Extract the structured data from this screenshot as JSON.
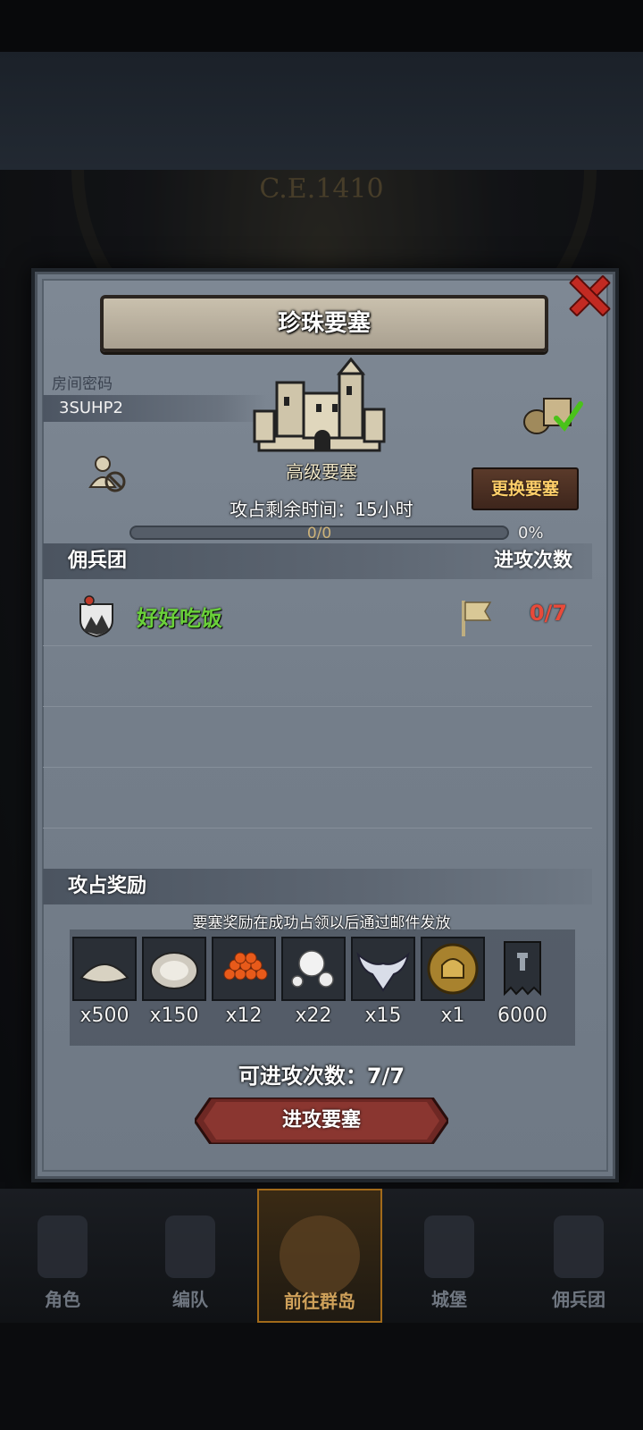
{
  "background": {
    "era_text": "C.E.1410"
  },
  "dialog": {
    "title": "珍珠要塞",
    "room_code_label": "房间密码",
    "room_code": "3SUHP2",
    "fortress_level": "高级要塞",
    "change_button": "更换要塞",
    "time_label": "攻占剩余时间：15小时",
    "progress": {
      "text": "0/0",
      "percent_text": "0%",
      "value": 0
    },
    "mercenary_section": {
      "left": "佣兵团",
      "right": "进攻次数"
    },
    "mercenary_rows": [
      {
        "name": "好好吃饭",
        "attacks": "0/7"
      }
    ],
    "reward_section": {
      "title": "攻占奖励",
      "note": "要塞奖励在成功占领以后通过邮件发放"
    },
    "rewards": [
      {
        "icon": "flour-pile-icon",
        "qty": "x500"
      },
      {
        "icon": "oyster-icon",
        "qty": "x150"
      },
      {
        "icon": "roe-icon",
        "qty": "x12"
      },
      {
        "icon": "pearls-icon",
        "qty": "x22"
      },
      {
        "icon": "winged-emblem-icon",
        "qty": "x15"
      },
      {
        "icon": "knight-coin-icon",
        "qty": "x1"
      },
      {
        "icon": "banner-icon",
        "qty": "6000"
      }
    ],
    "attack_count_label": "可进攻次数：7/7",
    "attack_button": "进攻要塞"
  },
  "tabbar": [
    {
      "label": "角色",
      "icon": "knight-icon"
    },
    {
      "label": "编队",
      "icon": "helmet-icon"
    },
    {
      "label": "前往群岛",
      "icon": "island-compass-icon",
      "active": true
    },
    {
      "label": "城堡",
      "icon": "castle-icon"
    },
    {
      "label": "佣兵团",
      "icon": "mercenary-icon"
    }
  ],
  "colors": {
    "mercenary_name": "#6ad03a",
    "attack_count": "#e84a3a",
    "change_button_text": "#ffcf6a",
    "attack_button": "#7a2a26"
  }
}
